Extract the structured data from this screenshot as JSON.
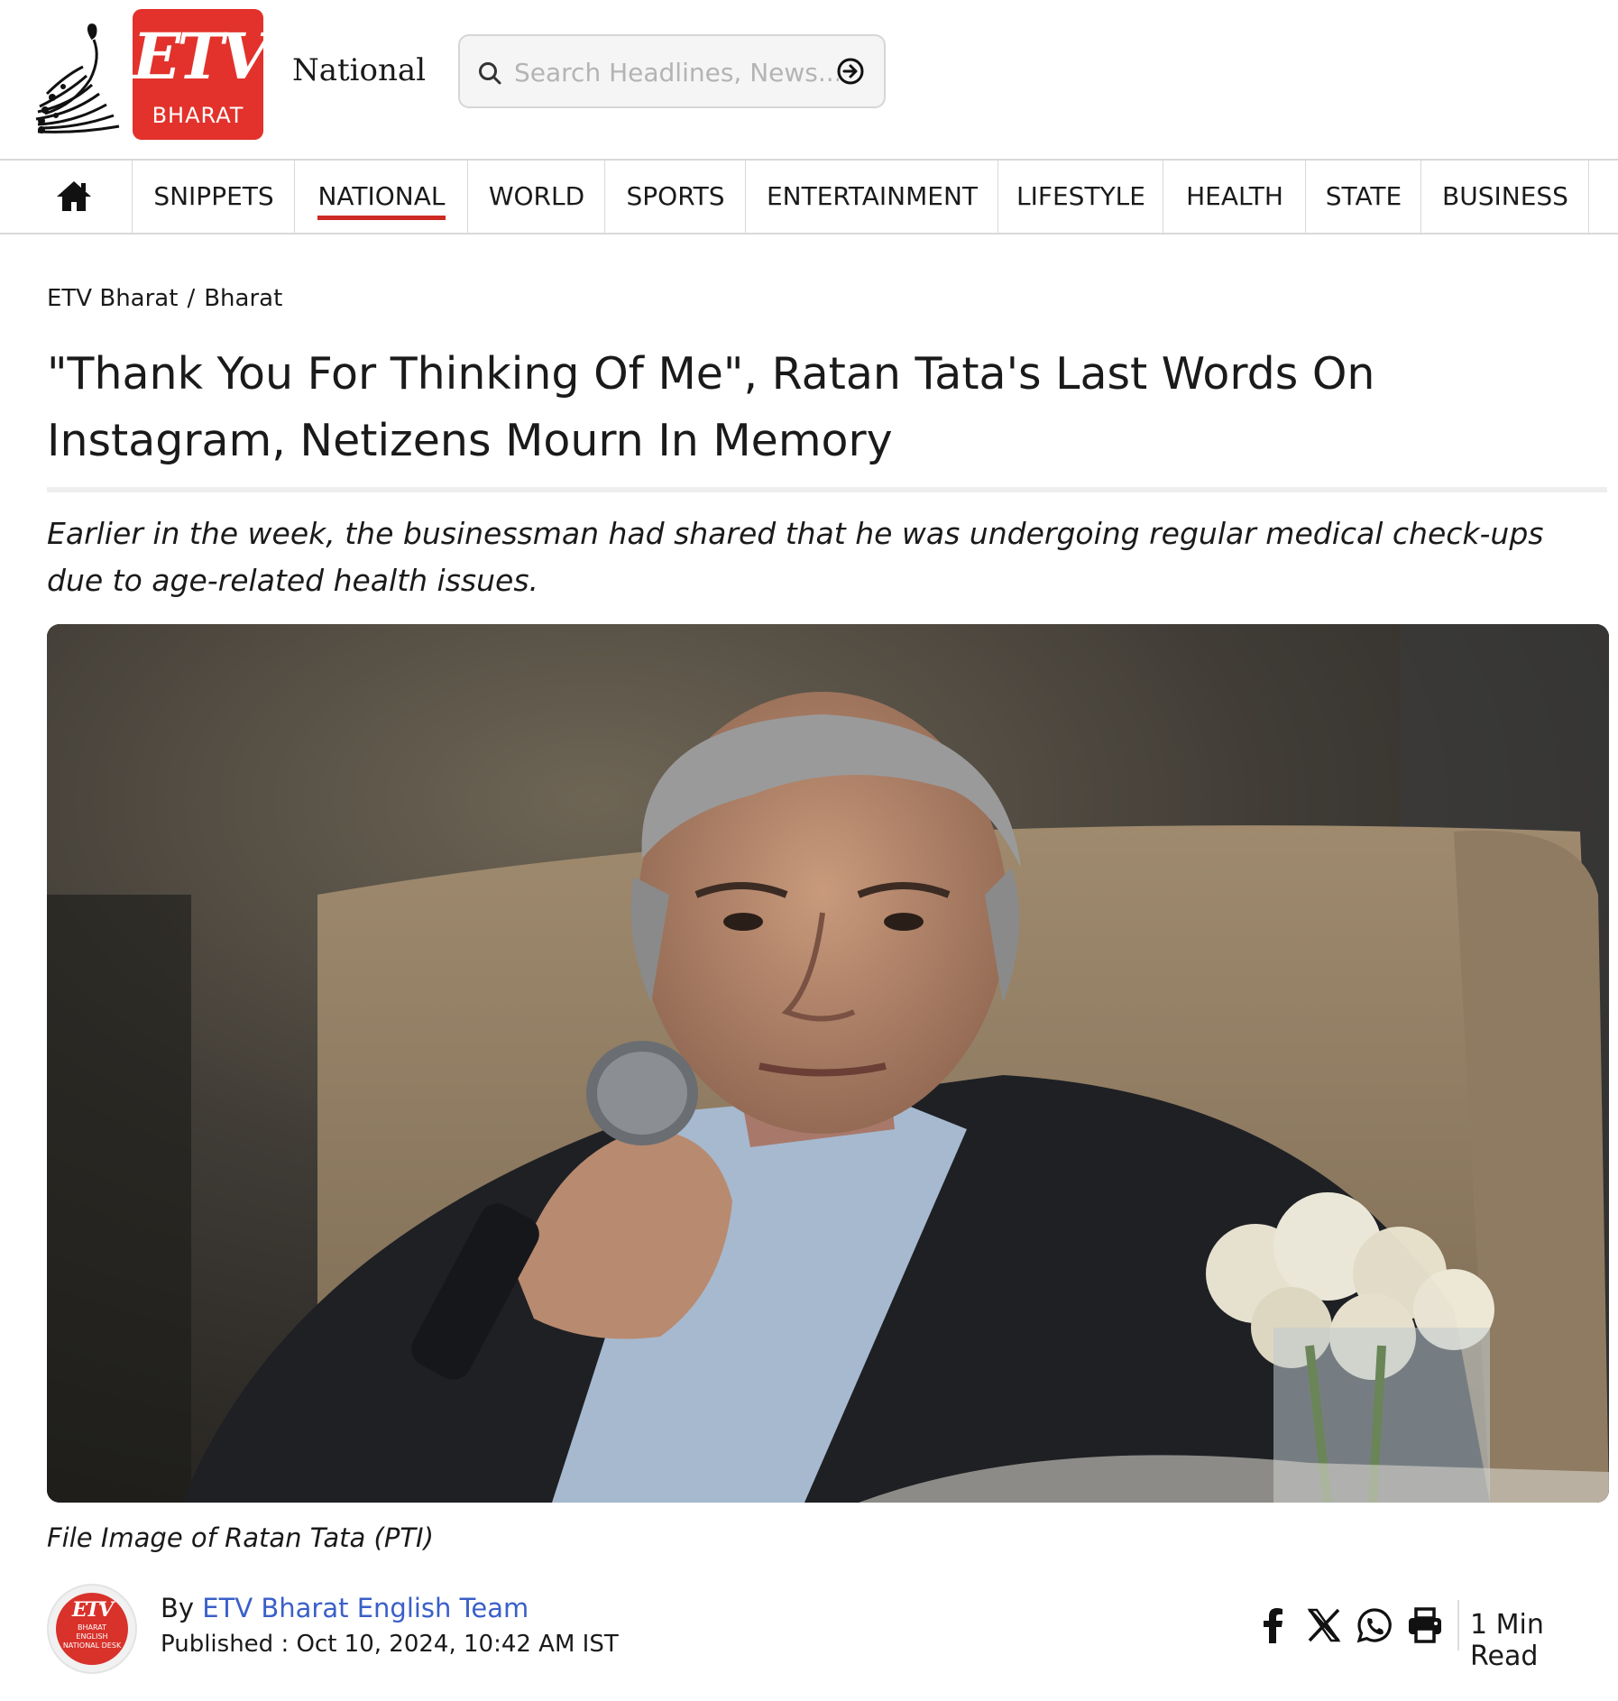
{
  "header": {
    "logo_text": "ETV",
    "logo_subtext": "BHARAT",
    "section_name": "National",
    "search_placeholder": "Search Headlines, News..."
  },
  "nav": {
    "home_icon": "home-icon",
    "items": [
      {
        "label": "SNIPPETS",
        "active": false
      },
      {
        "label": "NATIONAL",
        "active": true
      },
      {
        "label": "WORLD",
        "active": false
      },
      {
        "label": "SPORTS",
        "active": false
      },
      {
        "label": "ENTERTAINMENT",
        "active": false
      },
      {
        "label": "LIFESTYLE",
        "active": false
      },
      {
        "label": "HEALTH",
        "active": false
      },
      {
        "label": "STATE",
        "active": false
      },
      {
        "label": "BUSINESS",
        "active": false
      }
    ],
    "active_color": "#cc2a22"
  },
  "breadcrumb": [
    "ETV Bharat",
    "/",
    "Bharat"
  ],
  "article": {
    "headline": "\"Thank You For Thinking Of Me\", Ratan Tata's Last Words On Instagram, Netizens Mourn In Memory",
    "subhead": "Earlier in the week, the businessman had shared that he was undergoing regular medical check-ups due to age-related health issues.",
    "image_caption": "File Image of Ratan Tata (PTI)",
    "byline_prefix": "By",
    "author": "ETV Bharat English Team",
    "published": "Published : Oct 10, 2024, 10:42 AM IST",
    "read_time": "1 Min Read",
    "author_avatar": {
      "logo_text": "ETV",
      "lines": [
        "BHARAT",
        "ENGLISH",
        "NATIONAL DESK"
      ]
    }
  },
  "share_icons": [
    "facebook-icon",
    "x-icon",
    "whatsapp-icon",
    "print-icon"
  ],
  "colors": {
    "brand_red": "#e2322b",
    "link_blue": "#3a5fc8"
  }
}
